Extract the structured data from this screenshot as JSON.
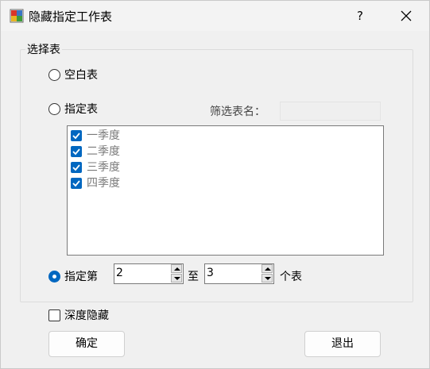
{
  "window": {
    "title": "隐藏指定工作表",
    "help_label": "?"
  },
  "group": {
    "legend": "选择表"
  },
  "options": {
    "blank_sheet_label": "空白表",
    "specified_sheet_label": "指定表",
    "filter_label": "筛选表名：",
    "filter_value": "",
    "sheets": [
      {
        "label": "一季度",
        "checked": true
      },
      {
        "label": "二季度",
        "checked": true
      },
      {
        "label": "三季度",
        "checked": true
      },
      {
        "label": "四季度",
        "checked": true
      }
    ],
    "range_label_prefix": "指定第",
    "range_from": "2",
    "range_to_label": "至",
    "range_to": "3",
    "range_suffix": "个表",
    "selected_option": "range"
  },
  "deep_hide": {
    "label": "深度隐藏",
    "checked": false
  },
  "buttons": {
    "ok": "确定",
    "exit": "退出"
  },
  "colors": {
    "accent": "#0067c0"
  }
}
